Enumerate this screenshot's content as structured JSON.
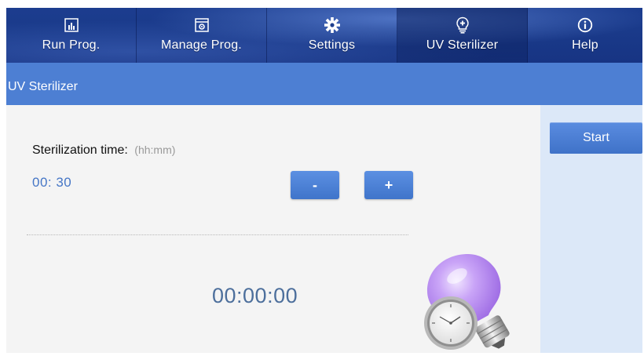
{
  "nav": {
    "tabs": [
      {
        "label": "Run Prog.",
        "icon": "chart-icon",
        "active": false
      },
      {
        "label": "Manage Prog.",
        "icon": "program-icon",
        "active": false
      },
      {
        "label": "Settings",
        "icon": "gear-icon",
        "active": false
      },
      {
        "label": "UV Sterilizer",
        "icon": "bulb-plus-icon",
        "active": true
      },
      {
        "label": "Help",
        "icon": "info-icon",
        "active": false
      }
    ]
  },
  "titlebar": {
    "title": "UV Sterilizer"
  },
  "main": {
    "sterilization_label": "Sterilization time:",
    "sterilization_unit": "(hh:mm)",
    "sterilization_value": "00: 30",
    "minus_label": "-",
    "plus_label": "+",
    "countdown": "00:00:00"
  },
  "sidebar": {
    "start_label": "Start"
  },
  "colors": {
    "nav_bg": "#1a3a8a",
    "title_bar": "#4d7fd3",
    "button_blue": "#4a7fd6",
    "value_blue": "#4576c6",
    "sidebar_bg": "#dce8f8",
    "bulb_purple": "#b98cf0"
  }
}
